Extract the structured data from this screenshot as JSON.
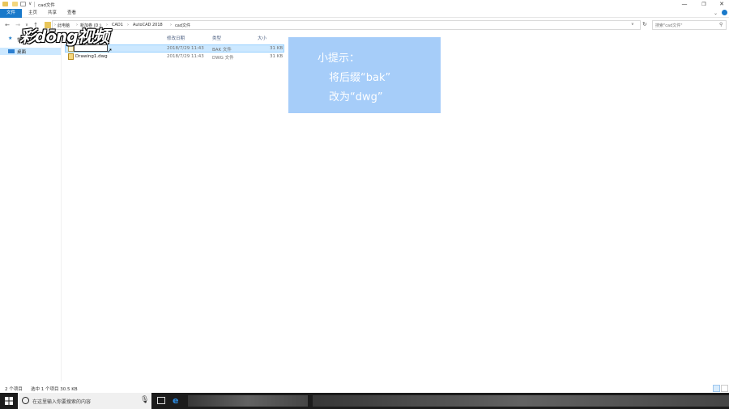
{
  "window": {
    "title": "cad文件",
    "quick_access_dropdown": "∨",
    "controls": {
      "minimize": "—",
      "maximize": "❐",
      "close": "✕"
    }
  },
  "ribbon": {
    "tabs": [
      {
        "label": "文件",
        "active": true
      },
      {
        "label": "主页",
        "active": false
      },
      {
        "label": "共享",
        "active": false
      },
      {
        "label": "查看",
        "active": false
      }
    ]
  },
  "address": {
    "crumbs": [
      "此电脑",
      "新加卷 (D:)",
      "CAD1",
      "AutoCAD 2018",
      "cad文件"
    ],
    "separator": "›"
  },
  "search": {
    "placeholder": "搜索\"cad文件\""
  },
  "nav_pane": {
    "items": [
      {
        "label": "快速",
        "icon": "star-icon"
      },
      {
        "label": "桌面",
        "icon": "desktop-icon",
        "selected": true
      }
    ]
  },
  "columns": {
    "modified": "修改日期",
    "type": "类型",
    "size": "大小"
  },
  "files": [
    {
      "name": "",
      "modified": "2018/7/29 11:43",
      "type": "BAK 文件",
      "size": "31 KB",
      "selected": true,
      "renaming": true
    },
    {
      "name": "Drawing1.dwg",
      "modified": "2018/7/29 11:43",
      "type": "DWG 文件",
      "size": "31 KB",
      "selected": false
    }
  ],
  "tip": {
    "line1": "小提示：",
    "line2": "将后缀“bak”",
    "line3": "改为“dwg”",
    "bg_color": "#a6cdf9"
  },
  "watermark": {
    "text": "彩dōng视频"
  },
  "status": {
    "item_count": "2 个项目",
    "selection": "选中 1 个项目  30.5 KB"
  },
  "taskbar": {
    "search_text": "在这里输入你要搜索的内容"
  },
  "colors": {
    "accent": "#1979ca",
    "selection": "#cce8ff",
    "taskbar": "#1c1c1c"
  }
}
